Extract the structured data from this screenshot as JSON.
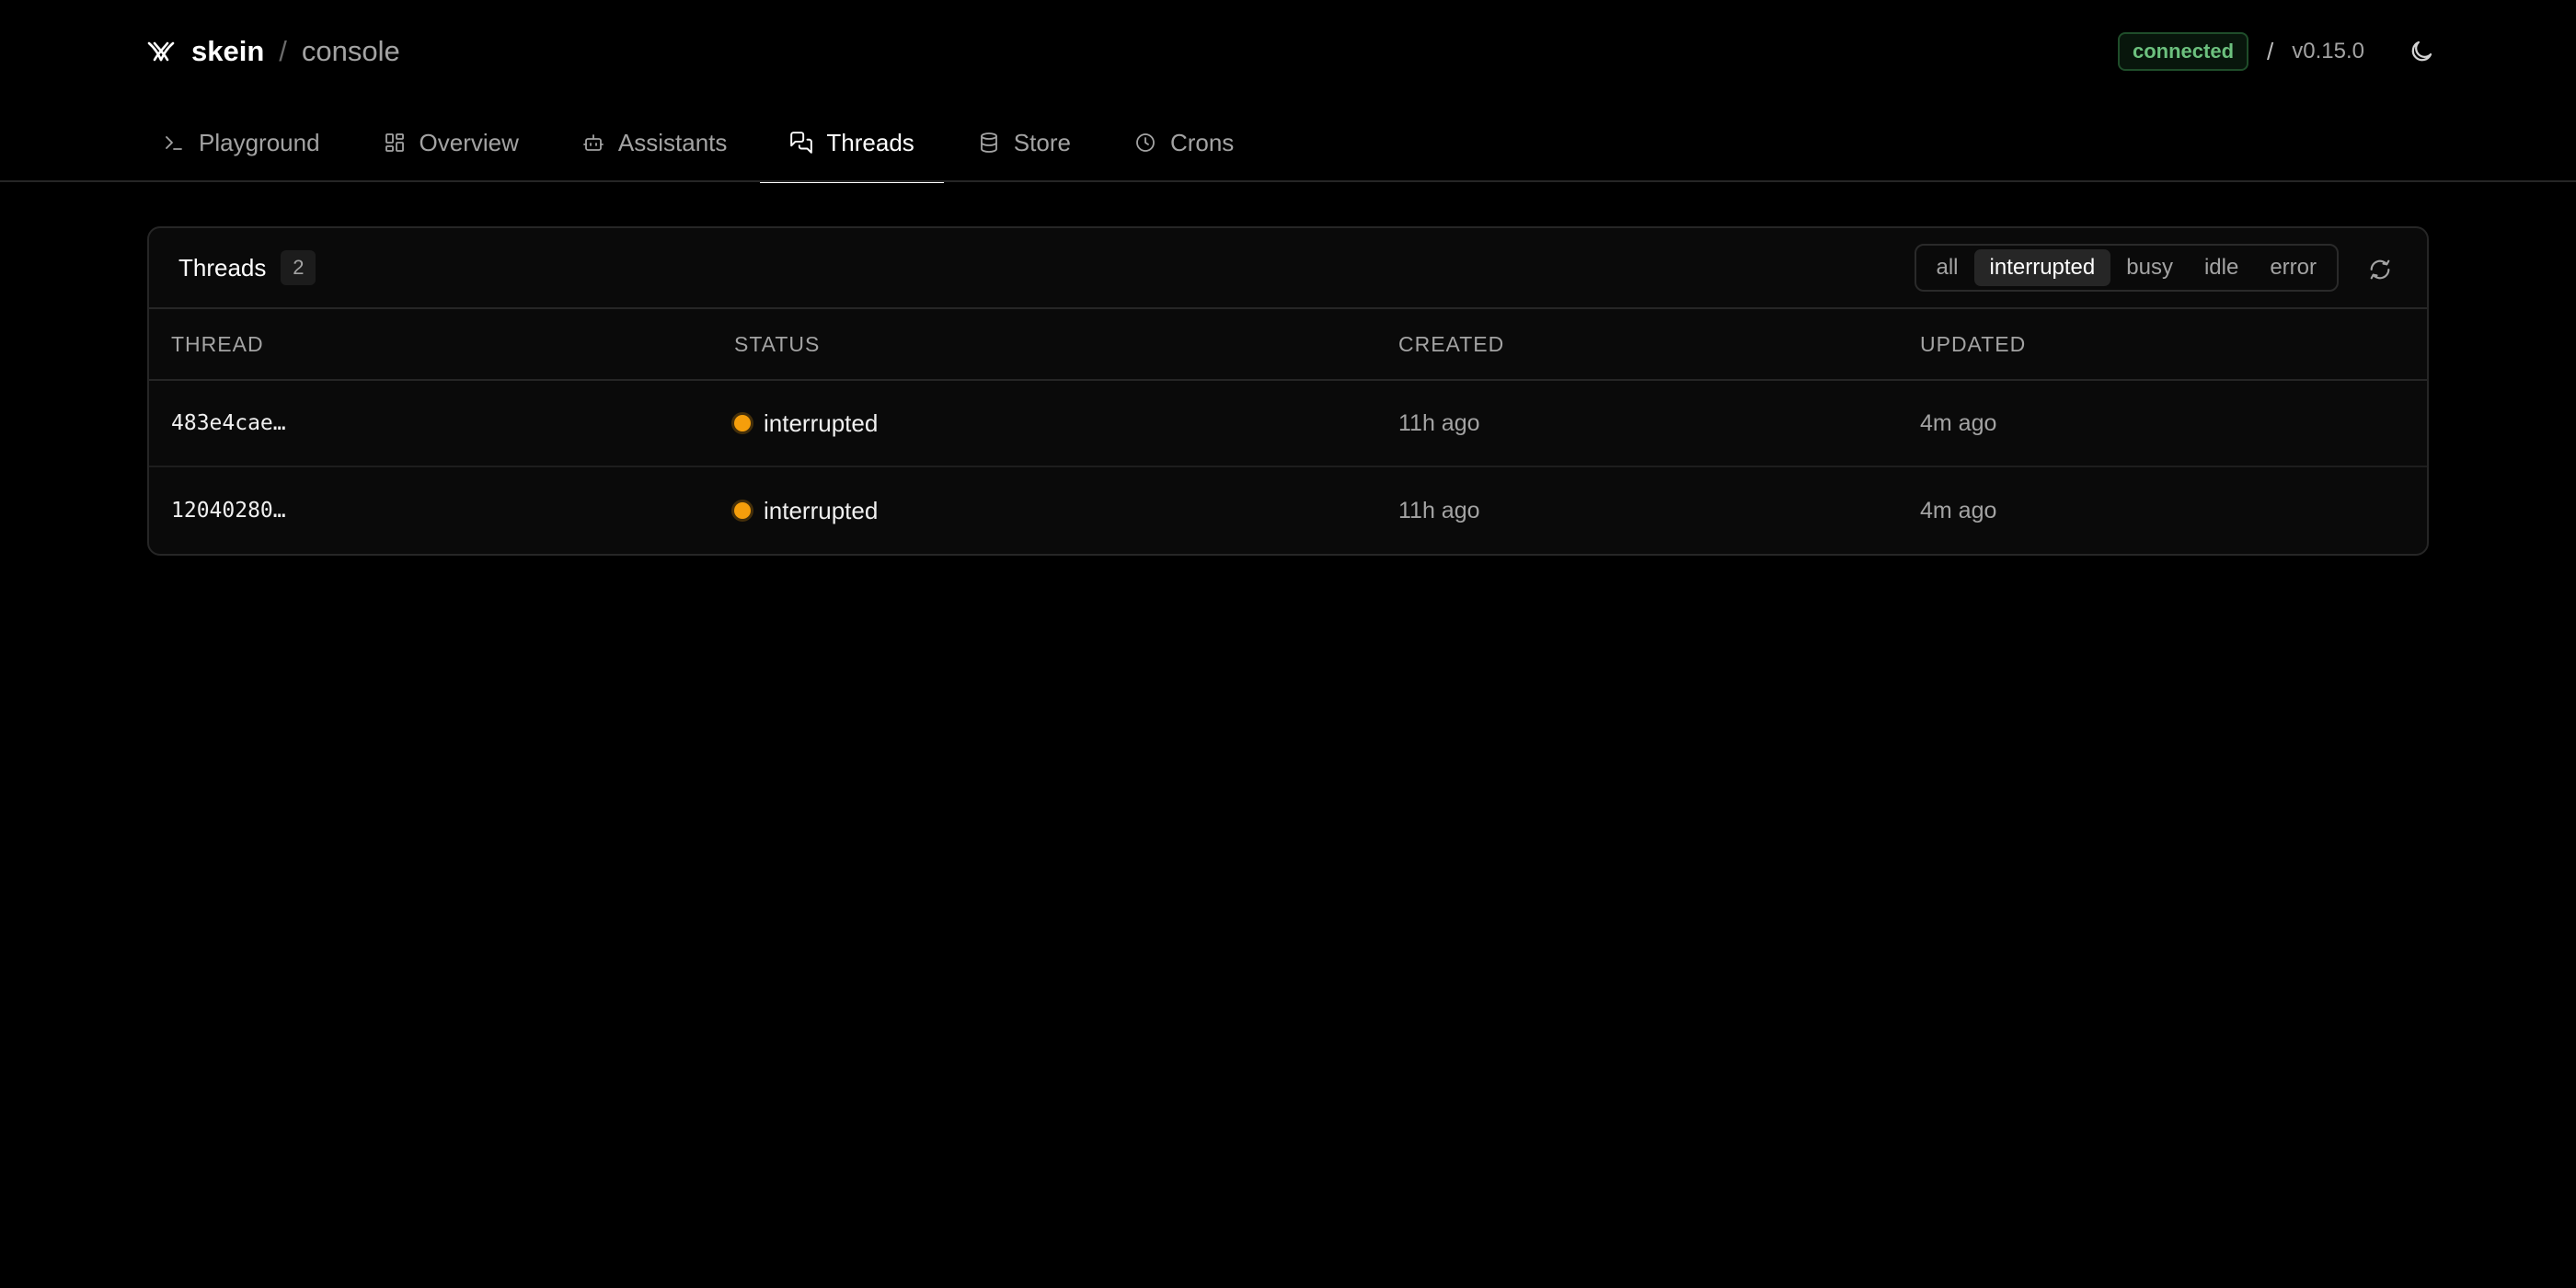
{
  "brand": {
    "name": "skein",
    "separator": "/",
    "sub": "console"
  },
  "status": {
    "connection": "connected",
    "separator": "/",
    "version": "v0.15.0"
  },
  "nav": {
    "tabs": [
      {
        "label": "Playground",
        "icon": "terminal-icon"
      },
      {
        "label": "Overview",
        "icon": "dashboard-icon"
      },
      {
        "label": "Assistants",
        "icon": "bot-icon"
      },
      {
        "label": "Threads",
        "icon": "chat-bubbles-icon",
        "active": true
      },
      {
        "label": "Store",
        "icon": "database-icon"
      },
      {
        "label": "Crons",
        "icon": "clock-icon"
      }
    ]
  },
  "panel": {
    "title": "Threads",
    "count": "2",
    "filters": [
      {
        "label": "all"
      },
      {
        "label": "interrupted",
        "active": true
      },
      {
        "label": "busy"
      },
      {
        "label": "idle"
      },
      {
        "label": "error"
      }
    ],
    "columns": [
      "THREAD",
      "STATUS",
      "CREATED",
      "UPDATED"
    ],
    "rows": [
      {
        "thread": "483e4cae…",
        "status": "interrupted",
        "created": "11h ago",
        "updated": "4m ago"
      },
      {
        "thread": "12040280…",
        "status": "interrupted",
        "created": "11h ago",
        "updated": "4m ago"
      }
    ]
  },
  "colors": {
    "background": "#000000",
    "connected": "#6cc07e",
    "interrupted": "#f59e0b",
    "border": "#262626"
  }
}
